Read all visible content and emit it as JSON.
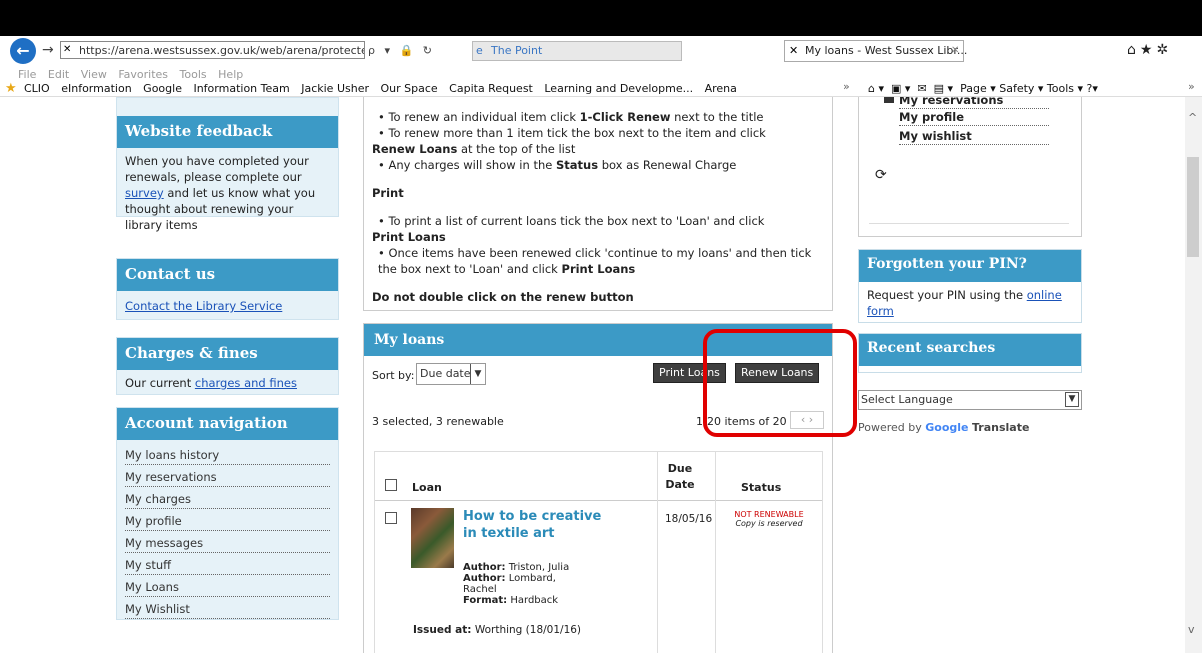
{
  "browser": {
    "url": "https://arena.westsussex.gov.uk/web/arena/protected/loans",
    "address_tools": "ρ ▾ 🔒 ↻",
    "tab1_title": "The Point",
    "tab2_title": "My loans - West Sussex Libr...",
    "menu": [
      "File",
      "Edit",
      "View",
      "Favorites",
      "Tools",
      "Help"
    ],
    "favorites": [
      "CLIO",
      "eInformation",
      "Google",
      "Information Team",
      "Jackie Usher",
      "Our Space",
      "Capita Request",
      "Learning and Developme...",
      "Arena"
    ],
    "toolbar_right": "Page ▾   Safety ▾   Tools ▾"
  },
  "left": {
    "feedback": {
      "title": "Website feedback",
      "text1": "When you have completed your renewals, please complete our",
      "link": "survey",
      "text2": "and let us know what you thought about renewing your library items"
    },
    "contact": {
      "title": "Contact us",
      "link": "Contact the Library Service"
    },
    "charges": {
      "title": "Charges & fines",
      "text": "Our current",
      "link": "charges and fines"
    },
    "account": {
      "title": "Account navigation",
      "items": [
        "My loans history",
        "My reservations",
        "My charges",
        "My profile",
        "My messages",
        "My stuff",
        "My Loans",
        "My Wishlist"
      ]
    }
  },
  "instructions": {
    "line1_pre": "To renew an individual item click ",
    "line1_bold": "1-Click Renew",
    "line1_post": " next to the title",
    "line2": "To renew more than 1 item tick the box next to the item and click",
    "line2_bold": "Renew Loans",
    "line2_post": " at the top of the list",
    "line3_pre": "Any charges will show in the ",
    "line3_bold": "Status",
    "line3_post": " box as Renewal Charge",
    "print_heading": "Print",
    "print1": "To print a list of current loans tick the box next to 'Loan' and click",
    "print1_bold": "Print Loans",
    "print2": "Once items have been renewed click 'continue to my loans' and then tick the box next to 'Loan' and click ",
    "print2_bold": "Print Loans",
    "warning": "Do not double click on the renew button"
  },
  "loans": {
    "title": "My loans",
    "sort_label": "Sort by:",
    "sort_value": "Due date",
    "print_button": "Print Loans",
    "renew_button": "Renew Loans",
    "selected_text": "3 selected, 3 renewable",
    "pagination": "1-20 items  of 20",
    "headers": {
      "loan": "Loan",
      "due": "Due Date",
      "status": "Status"
    },
    "item": {
      "title": "How to be creative in textile art",
      "author1_label": "Author:",
      "author1": "Triston, Julia",
      "author2_label": "Author:",
      "author2": "Lombard, Rachel",
      "format_label": "Format:",
      "format": "Hardback",
      "issued_label": "Issued at:",
      "issued": "Worthing (18/01/16)",
      "due": "18/05/16",
      "status": "NOT RENEWABLE",
      "status_note": "Copy is reserved"
    }
  },
  "right": {
    "links": [
      "My reservations",
      "My profile",
      "My wishlist"
    ],
    "pin": {
      "title": "Forgotten your PIN?",
      "text": "Request your PIN using the",
      "link": "online form"
    },
    "recent": {
      "title": "Recent searches"
    },
    "language": {
      "placeholder": "Select Language",
      "powered": "Powered by",
      "google": "Google",
      "translate": "Translate"
    }
  },
  "colors": {
    "accent": "#3c9ac6",
    "sidebar_bg": "#e6f2f8",
    "highlight": "#e00000",
    "status_red": "#cc0000"
  }
}
